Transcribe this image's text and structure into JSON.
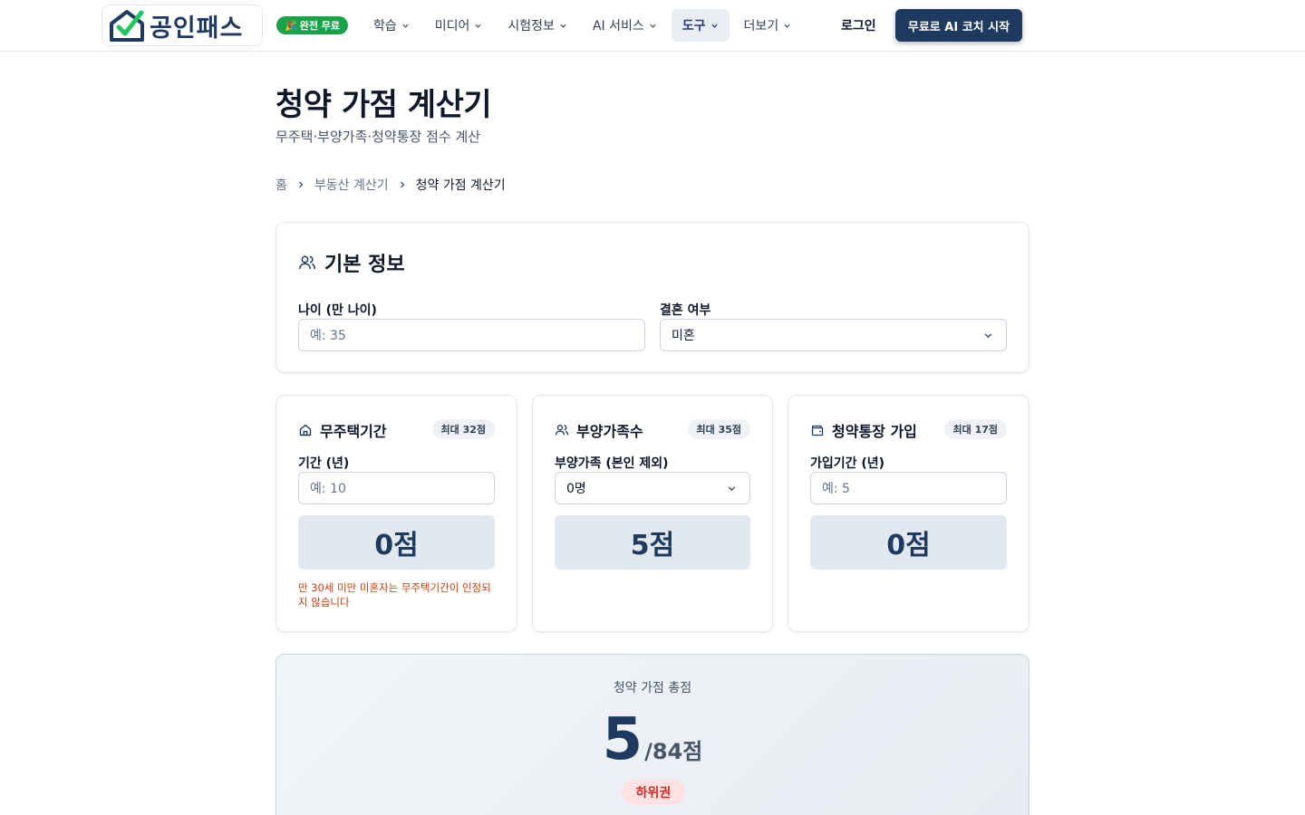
{
  "brand": {
    "name": "공인패스",
    "accent": "#1e3a5f",
    "check_color": "#22c55e"
  },
  "free_badge": {
    "icon": "party-popper-icon",
    "label": "완전 무료"
  },
  "nav": {
    "items": [
      {
        "label": "학습",
        "icon": "chevron-down-icon"
      },
      {
        "label": "미디어",
        "icon": "chevron-down-icon"
      },
      {
        "label": "시험정보",
        "icon": "chevron-down-icon"
      },
      {
        "label": "AI 서비스",
        "icon": "chevron-down-icon"
      },
      {
        "label": "도구",
        "icon": "chevron-down-icon",
        "active": true
      },
      {
        "label": "더보기",
        "icon": "chevron-down-icon"
      }
    ],
    "login": "로그인",
    "cta": "무료로 AI 코치 시작"
  },
  "page": {
    "title": "청약 가점 계산기",
    "subtitle": "무주택·부양가족·청약통장 점수 계산"
  },
  "breadcrumb": [
    "홈",
    "부동산 계산기",
    "청약 가점 계산기"
  ],
  "basic_info": {
    "icon": "users-icon",
    "title": "기본 정보",
    "age_label": "나이 (만 나이)",
    "age_placeholder": "예: 35",
    "marital_label": "결혼 여부",
    "marital_value": "미혼"
  },
  "cards": [
    {
      "icon": "house-icon",
      "title": "무주택기간",
      "max": "최대 32점",
      "field_label": "기간 (년)",
      "placeholder": "예: 10",
      "score": "0점",
      "warning": "만 30세 미만 미혼자는 무주택기간이 인정되지 않습니다"
    },
    {
      "icon": "users-icon",
      "title": "부양가족수",
      "max": "최대 35점",
      "field_label": "부양가족 (본인 제외)",
      "select_value": "0명",
      "score": "5점"
    },
    {
      "icon": "wallet-icon",
      "title": "청약통장 가입",
      "max": "최대 17점",
      "field_label": "가입기간 (년)",
      "placeholder": "예: 5",
      "score": "0점"
    }
  ],
  "total": {
    "label": "청약 가점 총점",
    "value": "5",
    "max": "/84점",
    "tier": "하위권",
    "tier_color": "#dc2626"
  }
}
